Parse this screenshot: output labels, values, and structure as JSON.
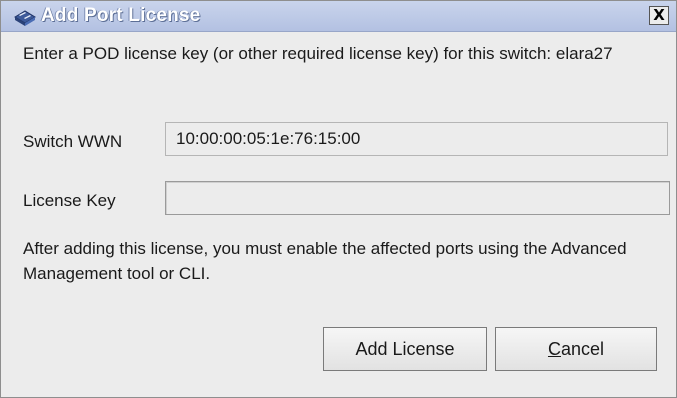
{
  "window": {
    "title": "Add Port License",
    "close_glyph": "X"
  },
  "content": {
    "instruction": "Enter a POD license key (or other required license key) for this switch: elara27",
    "switch_wwn_label": "Switch WWN",
    "switch_wwn_value": "10:00:00:05:1e:76:15:00",
    "license_key_label": "License Key",
    "license_key_value": "",
    "note": "After adding this license, you must enable the affected ports using the Advanced Management tool or CLI."
  },
  "buttons": {
    "add_license": "Add License",
    "cancel_first": "C",
    "cancel_rest": "ancel"
  },
  "colors": {
    "titlebar": "#b3c1e2",
    "dialog_background": "#ececec"
  },
  "icons": {
    "title_icon": "network-switch-icon",
    "close_icon": "close-icon"
  }
}
